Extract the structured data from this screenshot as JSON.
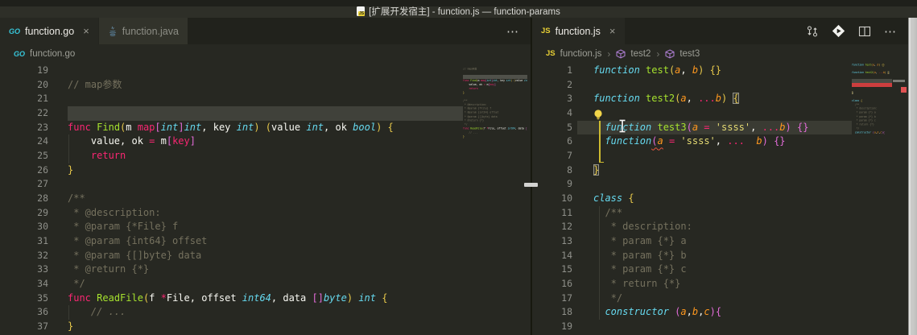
{
  "window": {
    "title": "[扩展开发宿主] - function.js — function-params"
  },
  "colors": {
    "editor_bg": "#272822",
    "keyword_pink": "#f92672",
    "function_green": "#a6e22e",
    "type_cyan": "#66d9ef",
    "param_orange": "#fd971f",
    "string_yellow": "#e6db74",
    "bracket_yellow": "#e8c94b",
    "bracket_magenta": "#e36cd9",
    "comment_gray": "#75715e",
    "error_red": "#cc3e3e",
    "current_line": "#3a3b33",
    "selection_line": "#40413a"
  },
  "left_group": {
    "tabs": [
      {
        "label": "function.go",
        "icon": "go-icon",
        "close_label": "×",
        "active": true
      },
      {
        "label": "function.java",
        "icon": "java-icon",
        "active": false
      }
    ],
    "more_actions_label": "⋯",
    "breadcrumb": {
      "file": "function.go"
    },
    "editor": {
      "lines": [
        {
          "n": 19,
          "tk": []
        },
        {
          "n": 20,
          "tk": [
            [
              "// map参数",
              "cm"
            ]
          ]
        },
        {
          "n": 21,
          "tk": []
        },
        {
          "n": 22,
          "tk": [],
          "hl": "sel"
        },
        {
          "n": 23,
          "tk": [
            [
              "func",
              "p"
            ],
            [
              " ",
              "w"
            ],
            [
              "Find",
              "g"
            ],
            [
              "(",
              "b1"
            ],
            [
              "m ",
              "w"
            ],
            [
              "map",
              "p"
            ],
            [
              "[",
              "b2"
            ],
            [
              "int",
              "c"
            ],
            [
              "]",
              "b2"
            ],
            [
              "int",
              "c"
            ],
            [
              ", key ",
              "w"
            ],
            [
              "int",
              "c"
            ],
            [
              ") (",
              "b1"
            ],
            [
              "value ",
              "w"
            ],
            [
              "int",
              "c"
            ],
            [
              ", ok ",
              "w"
            ],
            [
              "bool",
              "c"
            ],
            [
              ")",
              "b1"
            ],
            [
              " ",
              "w"
            ],
            [
              "{",
              "b1"
            ]
          ]
        },
        {
          "n": 24,
          "g": true,
          "tk": [
            [
              "    value, ok ",
              "w"
            ],
            [
              "=",
              "p"
            ],
            [
              " m",
              "w"
            ],
            [
              "[",
              "b2"
            ],
            [
              "key",
              "p"
            ],
            [
              "]",
              "b2"
            ]
          ]
        },
        {
          "n": 25,
          "g": true,
          "tk": [
            [
              "    ",
              "w"
            ],
            [
              "return",
              "p"
            ]
          ]
        },
        {
          "n": 26,
          "tk": [
            [
              "}",
              "b1"
            ]
          ]
        },
        {
          "n": 27,
          "tk": []
        },
        {
          "n": 28,
          "tk": [
            [
              "/**",
              "cm"
            ]
          ]
        },
        {
          "n": 29,
          "tk": [
            [
              " * @description:",
              "cm"
            ]
          ]
        },
        {
          "n": 30,
          "tk": [
            [
              " * @param {*File} f",
              "cm"
            ]
          ]
        },
        {
          "n": 31,
          "tk": [
            [
              " * @param {int64} offset",
              "cm"
            ]
          ]
        },
        {
          "n": 32,
          "tk": [
            [
              " * @param {[]byte} data",
              "cm"
            ]
          ]
        },
        {
          "n": 33,
          "tk": [
            [
              " * @return {*}",
              "cm"
            ]
          ]
        },
        {
          "n": 34,
          "tk": [
            [
              " */",
              "cm"
            ]
          ]
        },
        {
          "n": 35,
          "tk": [
            [
              "func",
              "p"
            ],
            [
              " ",
              "w"
            ],
            [
              "ReadFile",
              "g"
            ],
            [
              "(",
              "b1"
            ],
            [
              "f ",
              "w"
            ],
            [
              "*",
              "p"
            ],
            [
              "File, offset ",
              "w"
            ],
            [
              "int64",
              "c"
            ],
            [
              ", data ",
              "w"
            ],
            [
              "[]",
              "b2"
            ],
            [
              "byte",
              "c"
            ],
            [
              ")",
              "b1"
            ],
            [
              " ",
              "w"
            ],
            [
              "int",
              "c"
            ],
            [
              " ",
              "w"
            ],
            [
              "{",
              "b1"
            ]
          ]
        },
        {
          "n": 36,
          "g": true,
          "tk": [
            [
              "    ",
              "w"
            ],
            [
              "// ...",
              "cmi"
            ]
          ]
        },
        {
          "n": 37,
          "tk": [
            [
              "}",
              "b1"
            ]
          ]
        }
      ]
    }
  },
  "right_group": {
    "tab": {
      "label": "function.js",
      "icon": "js-icon",
      "close_label": "×",
      "active": true
    },
    "actions": [
      "compare-changes",
      "run-debug",
      "split-editor",
      "more-actions"
    ],
    "more_actions_label": "⋯",
    "breadcrumb": {
      "file": "function.js",
      "separator": "›",
      "symbols": [
        "test2",
        "test3"
      ]
    },
    "editor": {
      "lines": [
        {
          "n": 1,
          "tk": [
            [
              "function",
              "c"
            ],
            [
              " ",
              "w"
            ],
            [
              "test",
              "g"
            ],
            [
              "(",
              "b1"
            ],
            [
              "a",
              "o"
            ],
            [
              ", ",
              "w"
            ],
            [
              "b",
              "o"
            ],
            [
              ")",
              "b1"
            ],
            [
              " ",
              "w"
            ],
            [
              "{}",
              "b1"
            ]
          ]
        },
        {
          "n": 2,
          "tk": []
        },
        {
          "n": 3,
          "tk": [
            [
              "function",
              "c"
            ],
            [
              " ",
              "w"
            ],
            [
              "test2",
              "g"
            ],
            [
              "(",
              "b1"
            ],
            [
              "a",
              "o"
            ],
            [
              ", ",
              "w"
            ],
            [
              "...",
              "p"
            ],
            [
              "b",
              "o"
            ],
            [
              ")",
              "b1"
            ],
            [
              " ",
              "w"
            ],
            [
              "{",
              "b1 box"
            ]
          ]
        },
        {
          "n": 4,
          "tk": [],
          "bulb": true
        },
        {
          "n": 5,
          "hl": "cur",
          "tk": [
            [
              "  ",
              "w"
            ],
            [
              "function",
              "c"
            ],
            [
              " ",
              "w"
            ],
            [
              "test3",
              "g"
            ],
            [
              "(",
              "b2"
            ],
            [
              "a ",
              "o"
            ],
            [
              "=",
              "p"
            ],
            [
              " ",
              "w"
            ],
            [
              "'ssss'",
              "s"
            ],
            [
              ", ",
              "w"
            ],
            [
              "...",
              "p"
            ],
            [
              "b",
              "o"
            ],
            [
              ")",
              "b2"
            ],
            [
              " ",
              "w"
            ],
            [
              "{}",
              "b2"
            ]
          ]
        },
        {
          "n": 6,
          "tk": [
            [
              "  ",
              "w"
            ],
            [
              "function",
              "c"
            ],
            [
              "(",
              "b2 sq"
            ],
            [
              "a",
              "o sq"
            ],
            [
              " ",
              "w"
            ],
            [
              "=",
              "p"
            ],
            [
              " ",
              "w"
            ],
            [
              "'ssss'",
              "s"
            ],
            [
              ", ",
              "w"
            ],
            [
              "...",
              "p"
            ],
            [
              "  ",
              "w"
            ],
            [
              "b",
              "o"
            ],
            [
              ")",
              "b2"
            ],
            [
              " ",
              "w"
            ],
            [
              "{}",
              "b2"
            ]
          ]
        },
        {
          "n": 7,
          "tk": []
        },
        {
          "n": 8,
          "tk": [
            [
              "}",
              "b1 box"
            ]
          ]
        },
        {
          "n": 9,
          "tk": []
        },
        {
          "n": 10,
          "tk": [
            [
              "class",
              "c"
            ],
            [
              " ",
              "w"
            ],
            [
              "{",
              "b1"
            ]
          ]
        },
        {
          "n": 11,
          "g": true,
          "tk": [
            [
              "  /**",
              "cm"
            ]
          ]
        },
        {
          "n": 12,
          "g": true,
          "tk": [
            [
              "   * description:",
              "cm"
            ]
          ]
        },
        {
          "n": 13,
          "g": true,
          "tk": [
            [
              "   * param {*} a",
              "cm"
            ]
          ]
        },
        {
          "n": 14,
          "g": true,
          "tk": [
            [
              "   * param {*} b",
              "cm"
            ]
          ]
        },
        {
          "n": 15,
          "g": true,
          "tk": [
            [
              "   * param {*} c",
              "cm"
            ]
          ]
        },
        {
          "n": 16,
          "g": true,
          "tk": [
            [
              "   * return {*}",
              "cm"
            ]
          ]
        },
        {
          "n": 17,
          "g": true,
          "tk": [
            [
              "   */",
              "cm"
            ]
          ]
        },
        {
          "n": 18,
          "g": true,
          "tk": [
            [
              "  ",
              "w"
            ],
            [
              "constructor",
              "c"
            ],
            [
              " ",
              "w"
            ],
            [
              "(",
              "b2"
            ],
            [
              "a",
              "o"
            ],
            [
              ",",
              "w"
            ],
            [
              "b",
              "o"
            ],
            [
              ",",
              "w"
            ],
            [
              "c",
              "o"
            ],
            [
              ")",
              "b2"
            ],
            [
              "{",
              "b2"
            ]
          ]
        },
        {
          "n": 19,
          "tk": []
        }
      ]
    }
  }
}
